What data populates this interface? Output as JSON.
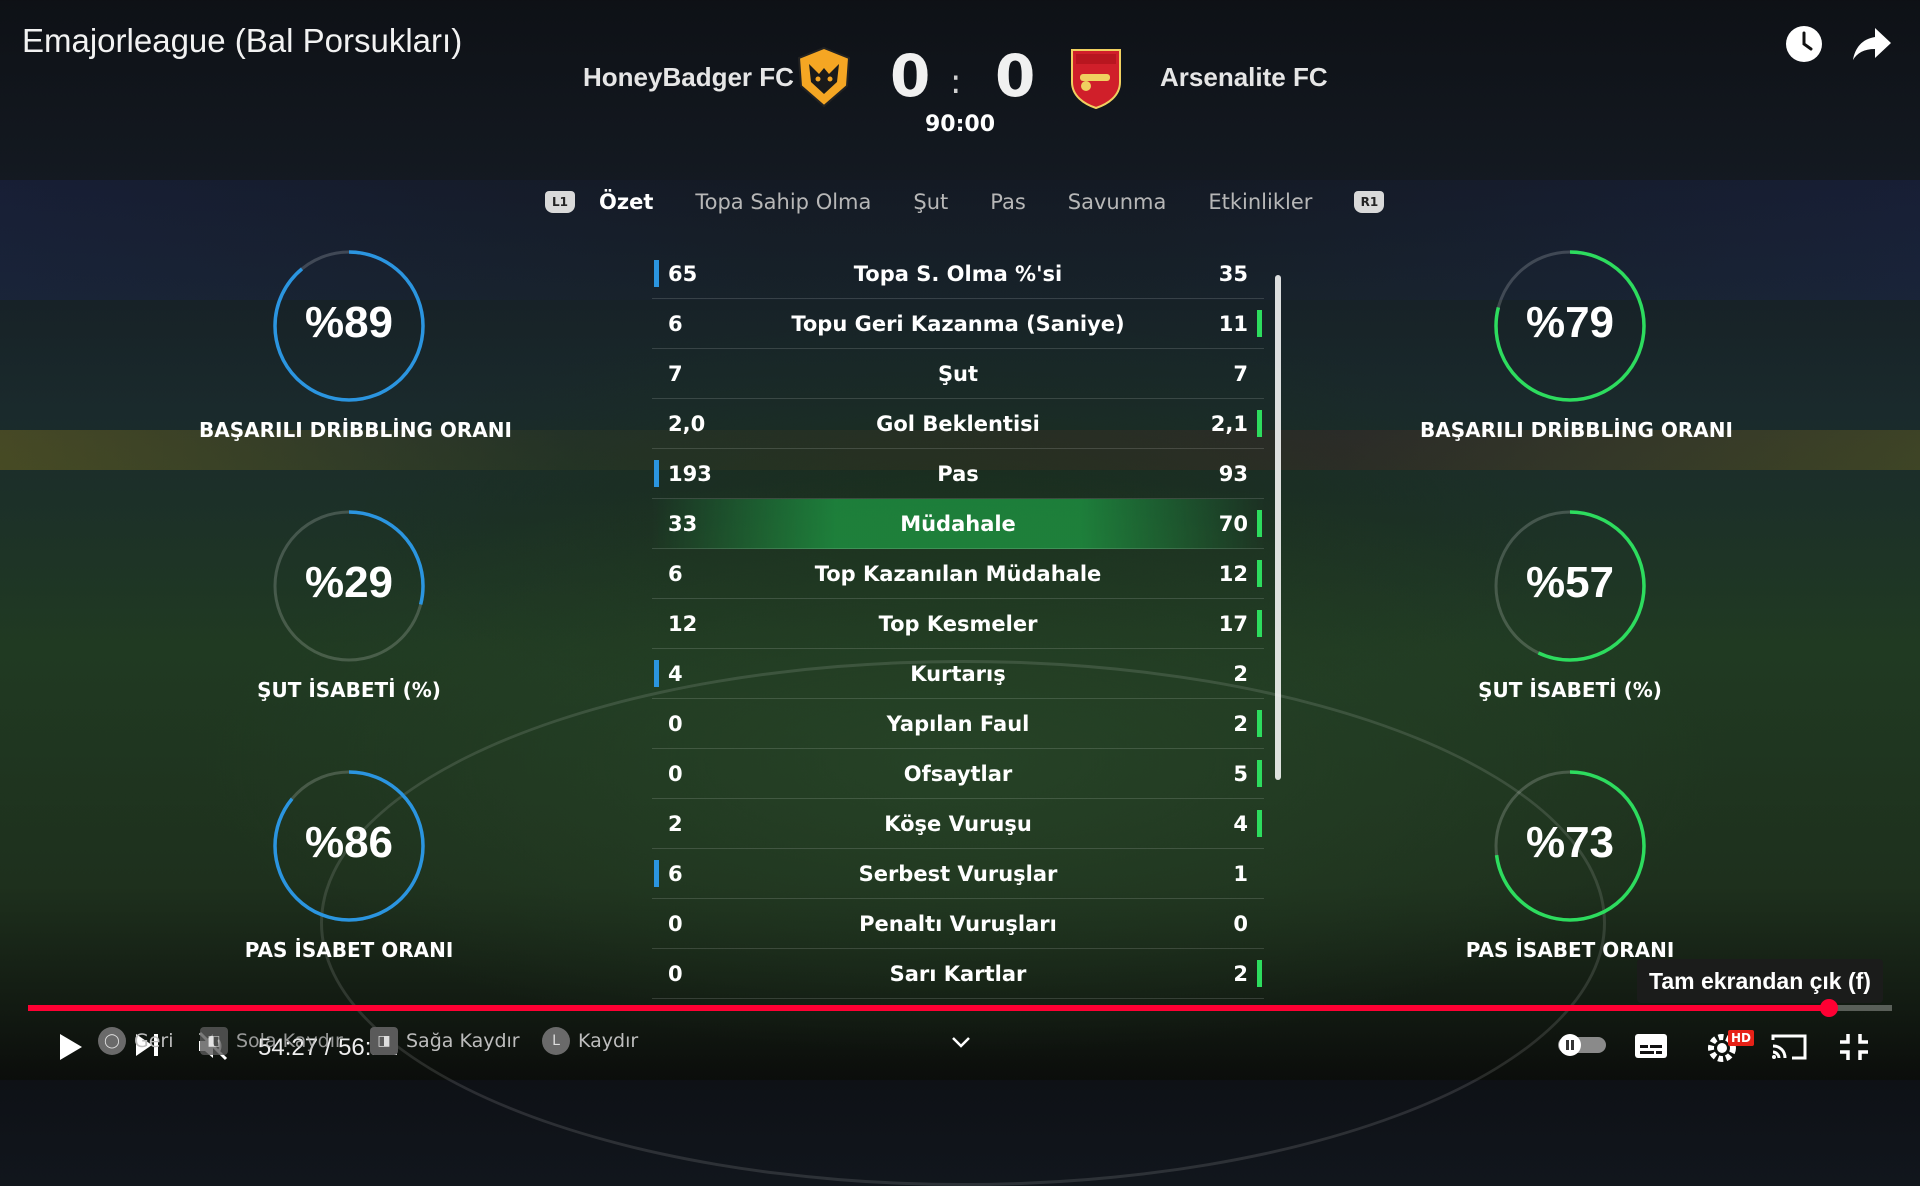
{
  "video": {
    "title": "Emajorleague (Bal Porsukları)"
  },
  "scoreboard": {
    "home_team": "HoneyBadger FC",
    "away_team": "Arsenalite FC",
    "home_score": "0",
    "away_score": "0",
    "separator": ":",
    "time": "90:00",
    "home_crest": "wolf-crest-icon",
    "away_crest": "cannon-crest-icon"
  },
  "tabs": {
    "left_bumper": "L1",
    "right_bumper": "R1",
    "items": [
      "Özet",
      "Topa Sahip Olma",
      "Şut",
      "Pas",
      "Savunma",
      "Etkinlikler"
    ],
    "active": "Özet"
  },
  "stats": [
    {
      "label": "Topa S. Olma %'si",
      "home": "65",
      "away": "35",
      "lead": "home"
    },
    {
      "label": "Topu Geri Kazanma (Saniye)",
      "home": "6",
      "away": "11",
      "lead": "away"
    },
    {
      "label": "Şut",
      "home": "7",
      "away": "7",
      "lead": "none"
    },
    {
      "label": "Gol Beklentisi",
      "home": "2,0",
      "away": "2,1",
      "lead": "away"
    },
    {
      "label": "Pas",
      "home": "193",
      "away": "93",
      "lead": "home"
    },
    {
      "label": "Müdahale",
      "home": "33",
      "away": "70",
      "lead": "away",
      "highlight": true
    },
    {
      "label": "Top Kazanılan Müdahale",
      "home": "6",
      "away": "12",
      "lead": "away"
    },
    {
      "label": "Top Kesmeler",
      "home": "12",
      "away": "17",
      "lead": "away"
    },
    {
      "label": "Kurtarış",
      "home": "4",
      "away": "2",
      "lead": "home"
    },
    {
      "label": "Yapılan Faul",
      "home": "0",
      "away": "2",
      "lead": "away"
    },
    {
      "label": "Ofsaytlar",
      "home": "0",
      "away": "5",
      "lead": "away"
    },
    {
      "label": "Köşe Vuruşu",
      "home": "2",
      "away": "4",
      "lead": "away"
    },
    {
      "label": "Serbest Vuruşlar",
      "home": "6",
      "away": "1",
      "lead": "home"
    },
    {
      "label": "Penaltı Vuruşları",
      "home": "0",
      "away": "0",
      "lead": "none"
    },
    {
      "label": "Sarı Kartlar",
      "home": "0",
      "away": "2",
      "lead": "away"
    }
  ],
  "gauges": {
    "home": [
      {
        "value_text": "%89",
        "percent": 89,
        "label": "BAŞARILI DRİBBLİNG ORANI"
      },
      {
        "value_text": "%29",
        "percent": 29,
        "label": "ŞUT İSABETİ (%)"
      },
      {
        "value_text": "%86",
        "percent": 86,
        "label": "PAS İSABET ORANI"
      }
    ],
    "away": [
      {
        "value_text": "%79",
        "percent": 79,
        "label": "BAŞARILI DRİBBLİNG ORANI"
      },
      {
        "value_text": "%57",
        "percent": 57,
        "label": "ŞUT İSABETİ (%)"
      },
      {
        "value_text": "%73",
        "percent": 73,
        "label": "PAS İSABET ORANI"
      }
    ]
  },
  "colors": {
    "home": "#2b95e0",
    "away": "#2ddc5e",
    "progress": "#ff0033"
  },
  "player": {
    "time_text": "54:27 / 56:22",
    "progress": 0.966,
    "tooltip": "Tam ekrandan çık (f)",
    "hints": [
      "Geri",
      "Sola Kaydır",
      "Sağa Kaydır",
      "Kaydır"
    ],
    "hd_badge": "HD"
  }
}
